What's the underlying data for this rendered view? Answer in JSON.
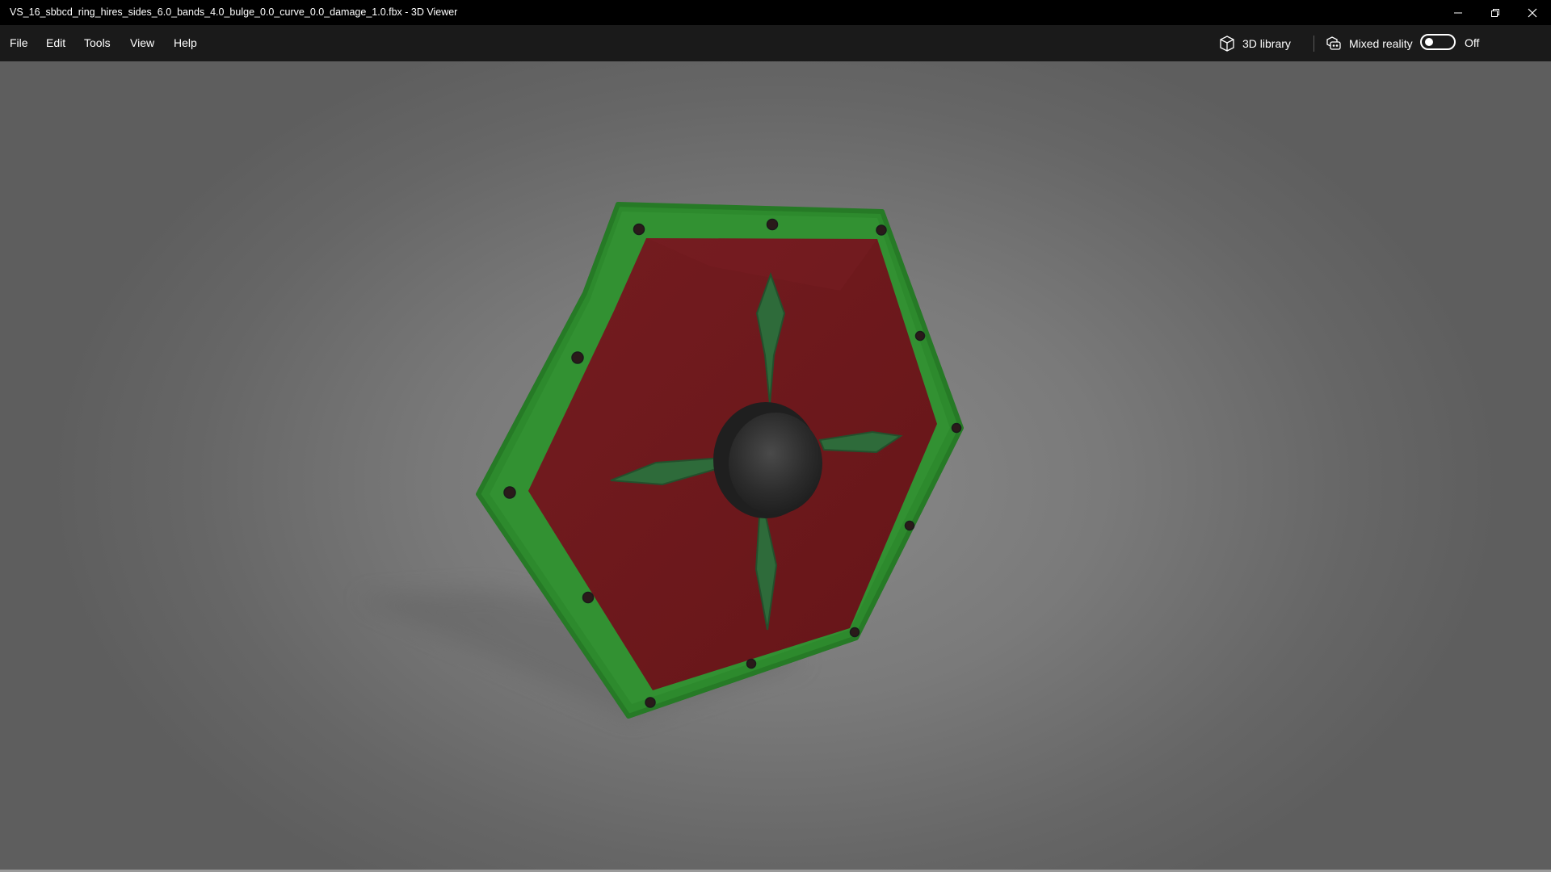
{
  "window": {
    "title": "VS_16_sbbcd_ring_hires_sides_6.0_bands_4.0_bulge_0.0_curve_0.0_damage_1.0.fbx - 3D Viewer"
  },
  "menu": {
    "file": "File",
    "edit": "Edit",
    "tools": "Tools",
    "view": "View",
    "help": "Help"
  },
  "toolbar": {
    "library_label": "3D library",
    "library_icon": "cube-icon",
    "mixed_reality_label": "Mixed reality",
    "mixed_reality_icon": "mixed-reality-icon",
    "mixed_reality_state": "Off",
    "mixed_reality_on": false
  },
  "colors": {
    "rim": "#2f8f2f",
    "face": "#6e1a1e",
    "cross": "#2e6b3a",
    "boss": "#2a2a2a"
  }
}
